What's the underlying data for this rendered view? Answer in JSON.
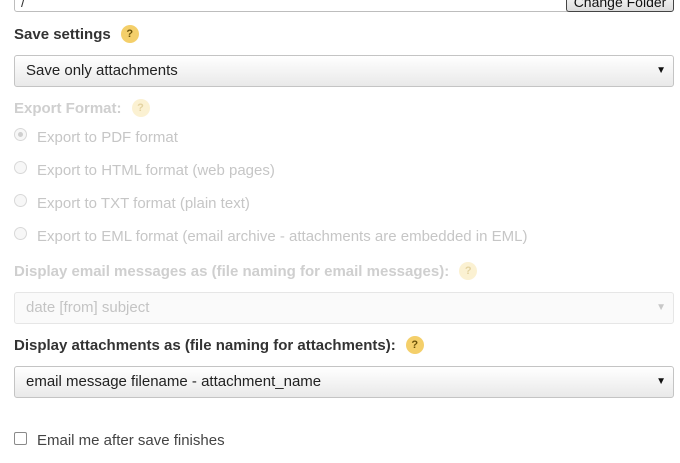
{
  "folder": {
    "path_value": "/",
    "change_button": "Change Folder"
  },
  "save_settings": {
    "label": "Save settings",
    "help": "?",
    "selected": "Save only attachments",
    "arrow": "▼"
  },
  "export_format": {
    "label": "Export Format:",
    "help": "?",
    "options": [
      {
        "label": "Export to PDF format",
        "checked": true
      },
      {
        "label": "Export to HTML format (web pages)",
        "checked": false
      },
      {
        "label": "Export to TXT format (plain text)",
        "checked": false
      },
      {
        "label": "Export to EML format (email archive - attachments are embedded in EML)",
        "checked": false
      }
    ]
  },
  "display_messages": {
    "label": "Display email messages as (file naming for email messages):",
    "help": "?",
    "selected": "date [from] subject",
    "arrow": "▼"
  },
  "display_attachments": {
    "label": "Display attachments as (file naming for attachments):",
    "help": "?",
    "selected": "email message filename - attachment_name",
    "arrow": "▼"
  },
  "email_me": {
    "label": "Email me after save finishes",
    "checked": false
  }
}
